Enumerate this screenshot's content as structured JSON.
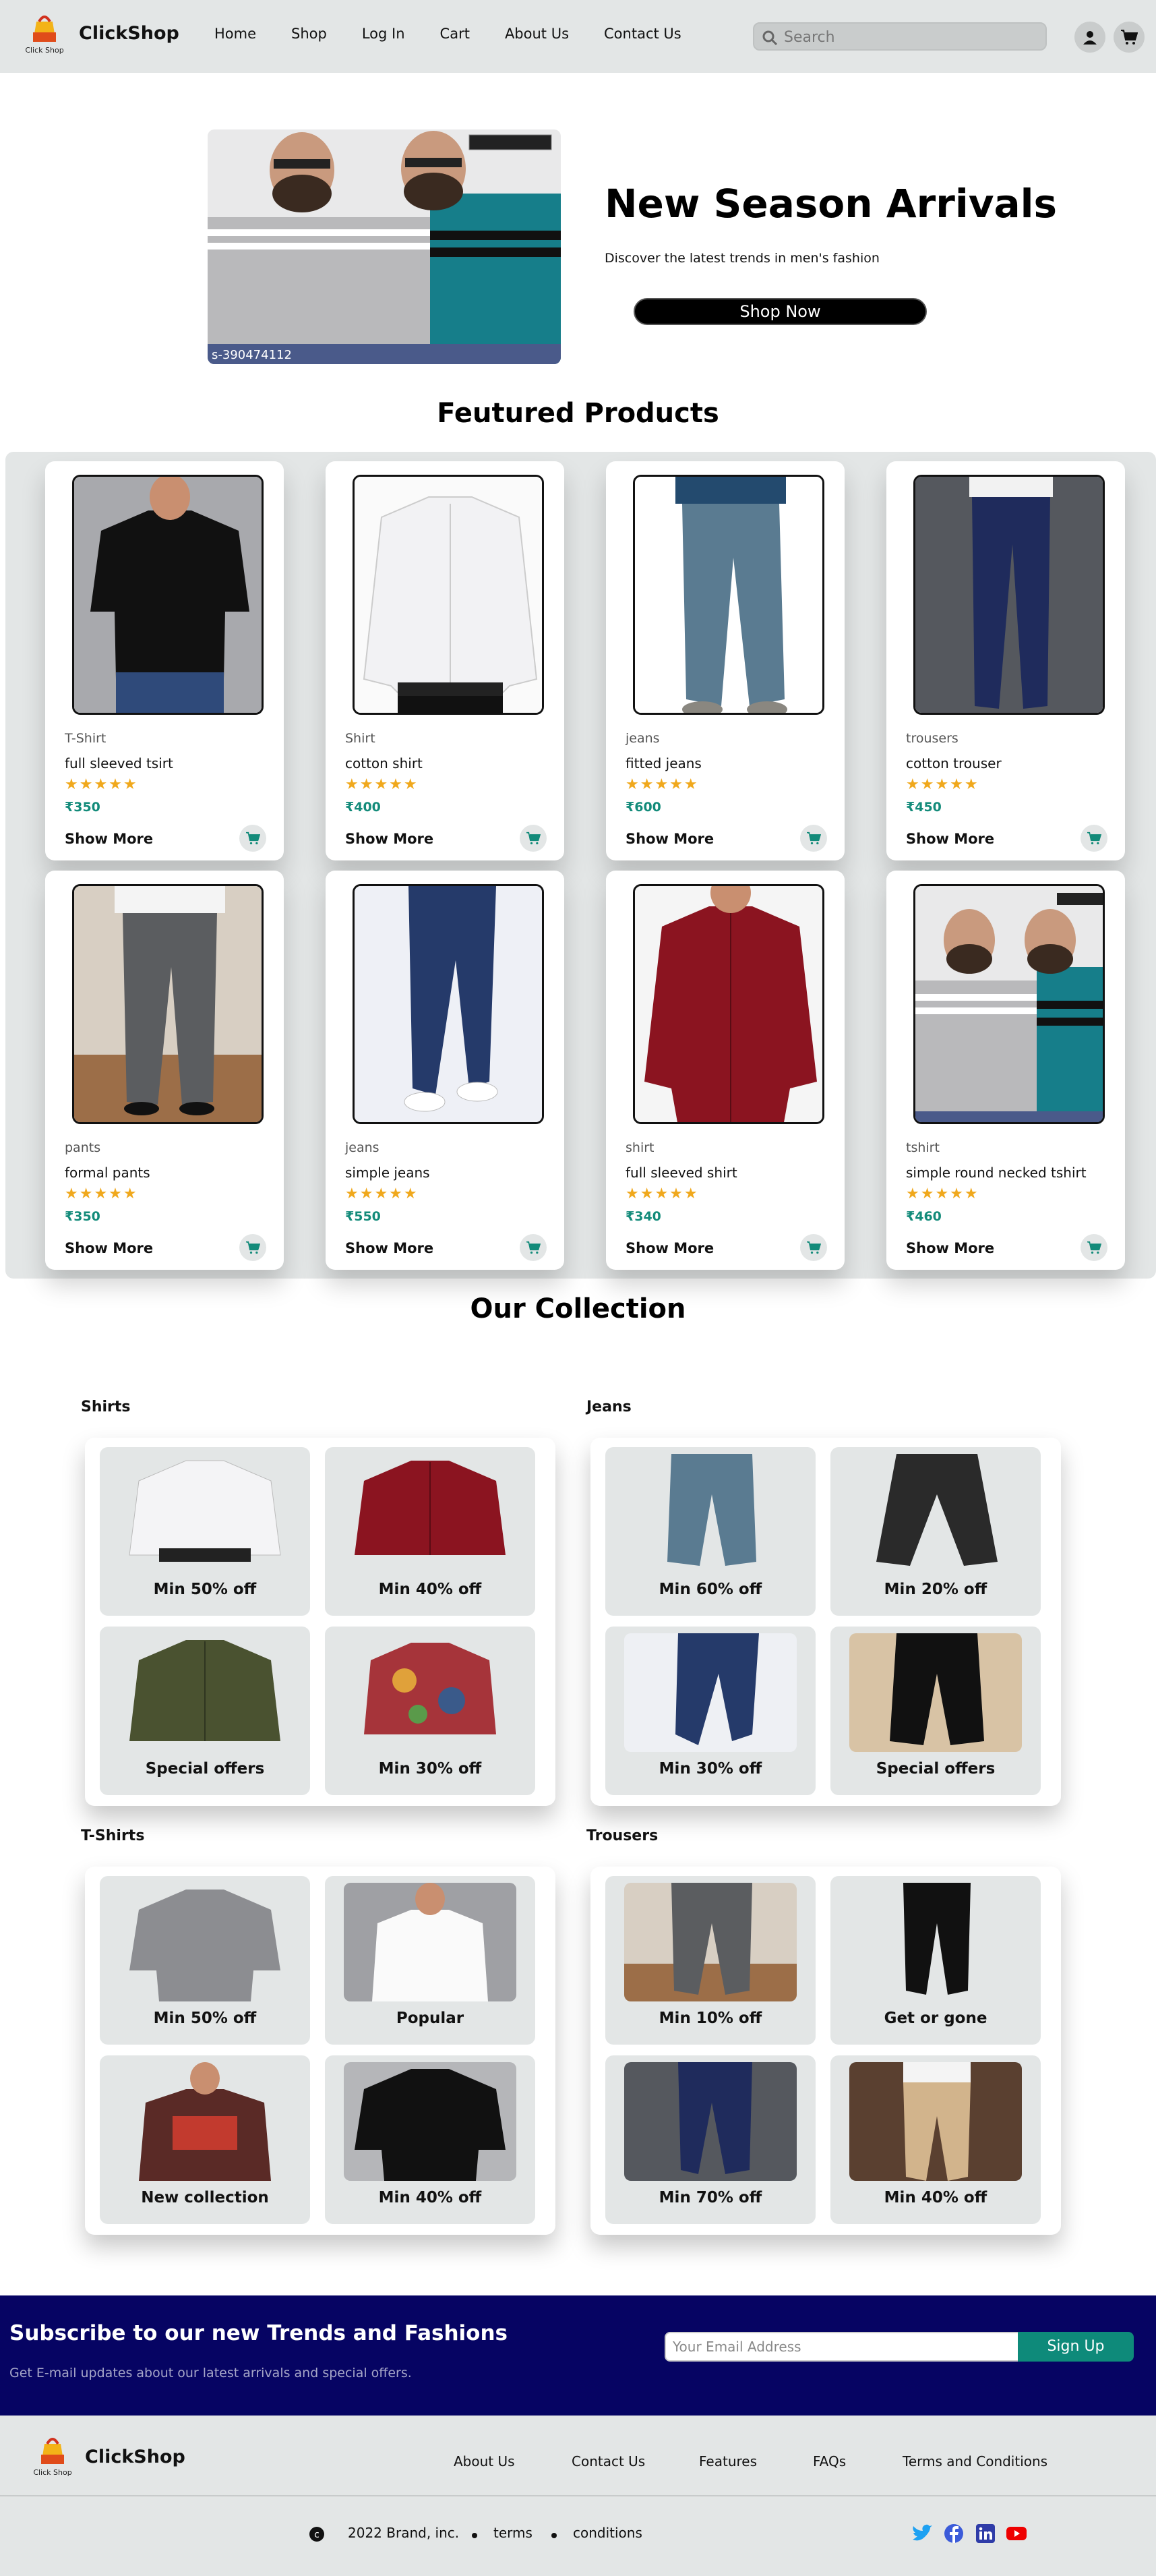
{
  "nav": {
    "brand": "ClickShop",
    "logo_text": "Click Shop",
    "links": [
      "Home",
      "Shop",
      "Log In",
      "Cart",
      "About Us",
      "Contact Us"
    ],
    "search_placeholder": "Search",
    "icons": [
      "user-icon",
      "cart-icon"
    ]
  },
  "hero": {
    "title": "New Season Arrivals",
    "subtitle": "Discover the latest trends in men's fashion",
    "button": "Shop Now",
    "image_watermark": "s-390474112"
  },
  "featured": {
    "title": "Feutured Products",
    "products": [
      {
        "category": "T-Shirt",
        "name": "full sleeved tsirt",
        "rating": 5,
        "price": "₹350",
        "more": "Show More"
      },
      {
        "category": "Shirt",
        "name": "cotton shirt",
        "rating": 5,
        "price": "₹400",
        "more": "Show More"
      },
      {
        "category": "jeans",
        "name": "fitted jeans",
        "rating": 5,
        "price": "₹600",
        "more": "Show More"
      },
      {
        "category": "trousers",
        "name": "cotton trouser",
        "rating": 5,
        "price": "₹450",
        "more": "Show More"
      },
      {
        "category": "pants",
        "name": "formal pants",
        "rating": 5,
        "price": "₹350",
        "more": "Show More"
      },
      {
        "category": "jeans",
        "name": "simple jeans",
        "rating": 5,
        "price": "₹550",
        "more": "Show More"
      },
      {
        "category": "shirt",
        "name": "full sleeved shirt",
        "rating": 5,
        "price": "₹340",
        "more": "Show More"
      },
      {
        "category": "tshirt",
        "name": "simple round necked tshirt",
        "rating": 5,
        "price": "₹460",
        "more": "Show More"
      }
    ],
    "stars": "★★★★★"
  },
  "collection": {
    "title": "Our Collection",
    "groups": [
      {
        "label": "Shirts",
        "tiles": [
          "Min 50% off",
          "Min 40% off",
          "Special offers",
          "Min 30% off"
        ]
      },
      {
        "label": "Jeans",
        "tiles": [
          "Min 60% off",
          "Min 20% off",
          "Min 30% off",
          "Special offers"
        ]
      },
      {
        "label": "T-Shirts",
        "tiles": [
          "Min 50% off",
          "Popular",
          "New collection",
          "Min 40% off"
        ]
      },
      {
        "label": "Trousers",
        "tiles": [
          "Min 10% off",
          "Get or gone",
          "Min 70% off",
          "Min 40% off"
        ]
      }
    ]
  },
  "subscribe": {
    "title": "Subscribe to our new Trends and Fashions",
    "desc": "Get E-mail updates about our latest arrivals and special offers.",
    "email_placeholder": "Your Email Address",
    "button": "Sign Up"
  },
  "footer": {
    "brand": "ClickShop",
    "links": [
      "About Us",
      "Contact Us",
      "Features",
      "FAQs",
      "Terms and Conditions"
    ],
    "copyright": "2022 Brand, inc.",
    "legal": [
      "terms",
      "conditions"
    ],
    "social": [
      "twitter-icon",
      "facebook-icon",
      "linkedin-icon",
      "youtube-icon"
    ]
  },
  "colors": {
    "nav_bg": "#e3e6e6",
    "price": "#138b7a",
    "star": "#f0a81c",
    "subscribe_bg": "#060463",
    "signup": "#0e8a7a"
  }
}
